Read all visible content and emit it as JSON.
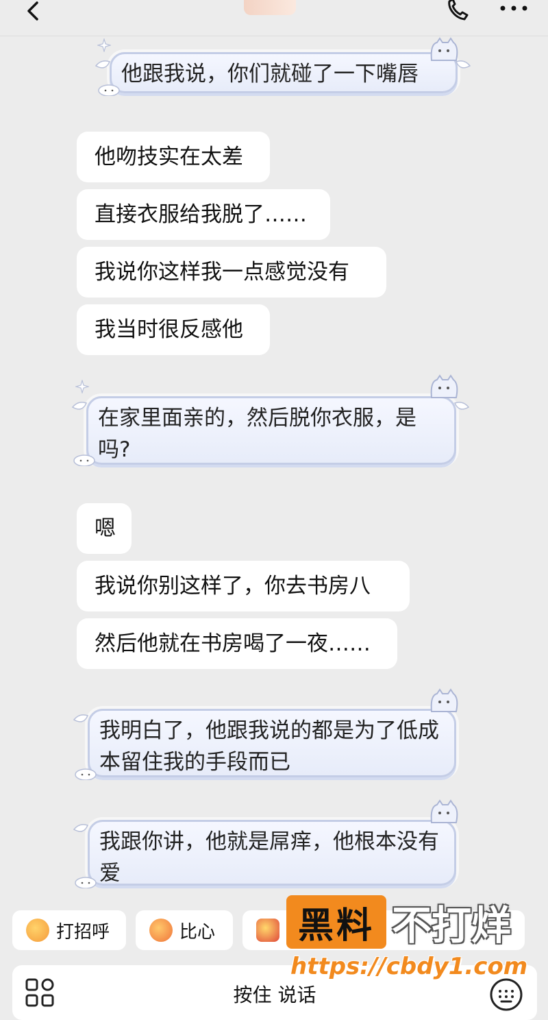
{
  "header": {
    "title_sliver": ""
  },
  "messages": [
    {
      "side": "me",
      "text": "他跟我说，你们就碰了一下嘴唇"
    },
    {
      "side": "other",
      "text": "他吻技实在太差"
    },
    {
      "side": "other",
      "text": "直接衣服给我脱了……"
    },
    {
      "side": "other",
      "text": "我说你这样我一点感觉没有"
    },
    {
      "side": "other",
      "text": "我当时很反感他"
    },
    {
      "side": "me",
      "text": "在家里面亲的，然后脱你衣服，是吗?"
    },
    {
      "side": "other",
      "text": "嗯"
    },
    {
      "side": "other",
      "text": "我说你别这样了，你去书房八"
    },
    {
      "side": "other",
      "text": "然后他就在书房喝了一夜……"
    },
    {
      "side": "me",
      "text": "我明白了，他跟我说的都是为了低成本留住我的手段而已"
    },
    {
      "side": "me",
      "text": "我跟你讲，他就是屌痒，他根本没有爱"
    }
  ],
  "quick_replies": [
    {
      "label": "打招呼",
      "icon": "wave-emoji-icon"
    },
    {
      "label": "比心",
      "icon": "heart-hands-emoji-icon"
    },
    {
      "label": "",
      "icon": "thumbs-up-emoji-icon"
    }
  ],
  "input_bar": {
    "voice_label": "按住 说话"
  },
  "watermark": {
    "box": "黑料",
    "text": "不打烊",
    "url": "https://cbdy1.com"
  },
  "colors": {
    "background": "#ececec",
    "bubble": "#ffffff",
    "sticker_border": "#c4cde6",
    "watermark_orange": "#f28a1e"
  }
}
